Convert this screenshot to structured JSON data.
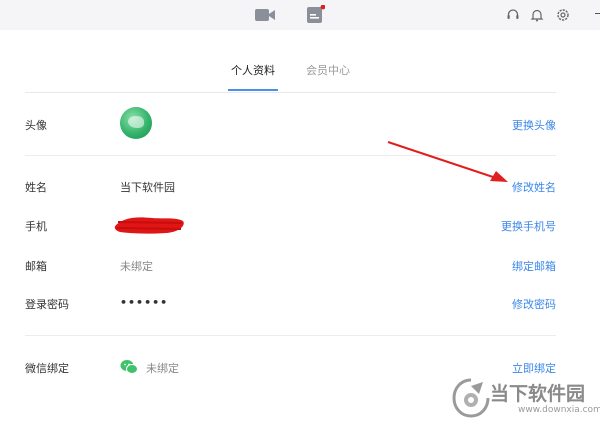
{
  "tabs": {
    "profile": "个人资料",
    "member": "会员中心"
  },
  "rows": {
    "avatar": {
      "label": "头像",
      "action": "更换头像"
    },
    "name": {
      "label": "姓名",
      "value": "当下软件园",
      "action": "修改姓名"
    },
    "phone": {
      "label": "手机",
      "action": "更换手机号"
    },
    "email": {
      "label": "邮箱",
      "value": "未绑定",
      "action": "绑定邮箱"
    },
    "password": {
      "label": "登录密码",
      "value": "••••••",
      "action": "修改密码"
    },
    "wechat": {
      "label": "微信绑定",
      "value": "未绑定",
      "action": "立即绑定"
    }
  },
  "icons": {
    "topbar": [
      "video-icon",
      "document-icon",
      "support-icon",
      "bell-icon",
      "settings-icon"
    ],
    "wechat": "wechat-icon"
  },
  "watermark": {
    "title": "当下软件园",
    "url": "www.downxia.com"
  },
  "colors": {
    "accent": "#3b87e8",
    "tab_underline": "#4a8fe8",
    "annotation_arrow": "#e02020",
    "notification_dot": "#e02020"
  }
}
